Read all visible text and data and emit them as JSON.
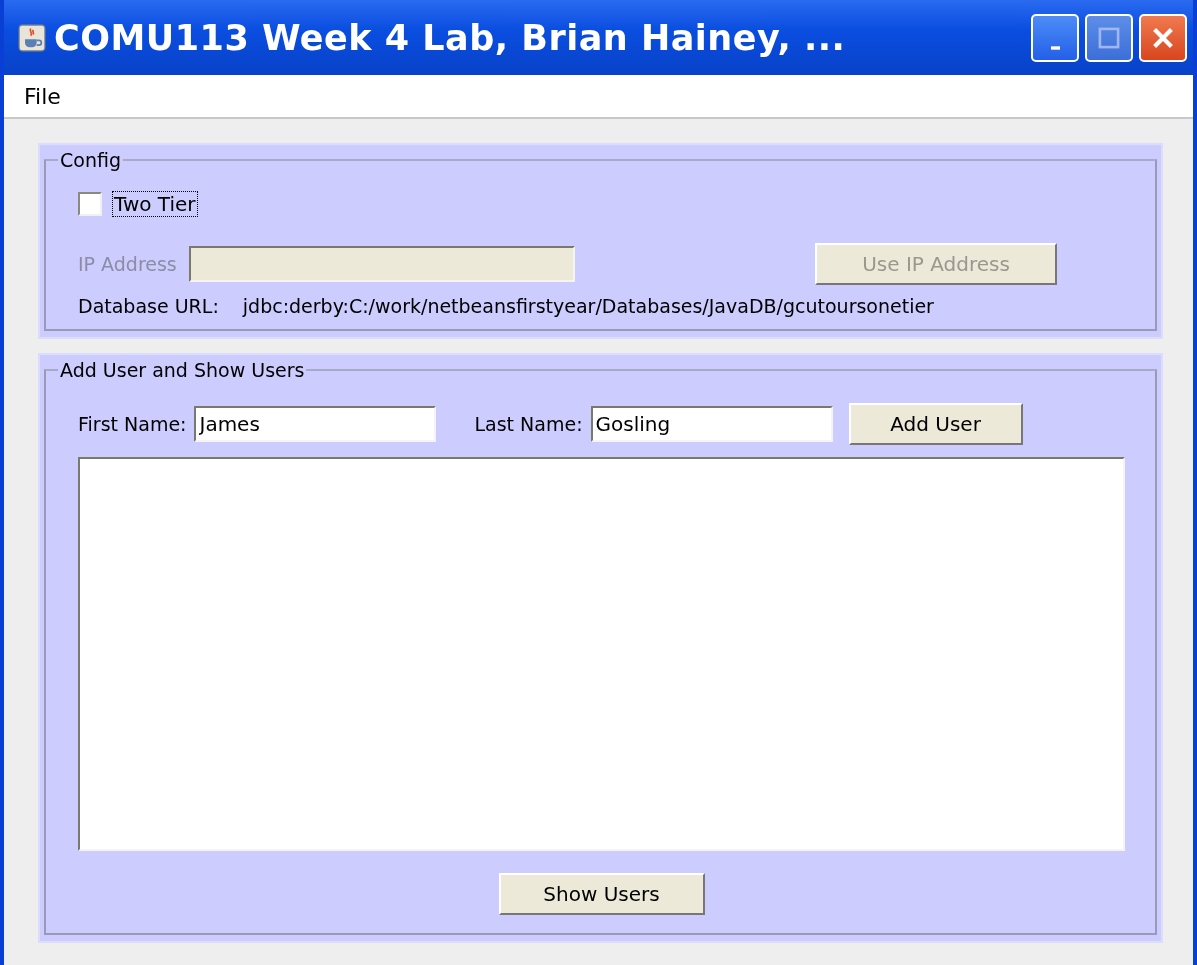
{
  "window": {
    "title": "COMU113 Week 4 Lab, Brian Hainey, ..."
  },
  "menu": [
    "File"
  ],
  "config": {
    "title": "Config",
    "two_tier": {
      "label": "Two Tier",
      "checked": false
    },
    "ip_address": {
      "label": "IP Address",
      "disabled": true
    },
    "use_ip_button": {
      "label": "Use IP Address",
      "disabled": true
    },
    "database_url": {
      "label": "Database URL:",
      "value": "jdbc:derby:C:/work/netbeansfirstyear/Databases/JavaDB/gcutoursonetier"
    }
  },
  "users": {
    "title": "Add User and Show Users",
    "first_name": {
      "label": "First Name:",
      "value": "James"
    },
    "last_name": {
      "label": "Last Name:",
      "value": "Gosling"
    },
    "add_button": "Add User",
    "show_button": "Show Users"
  }
}
